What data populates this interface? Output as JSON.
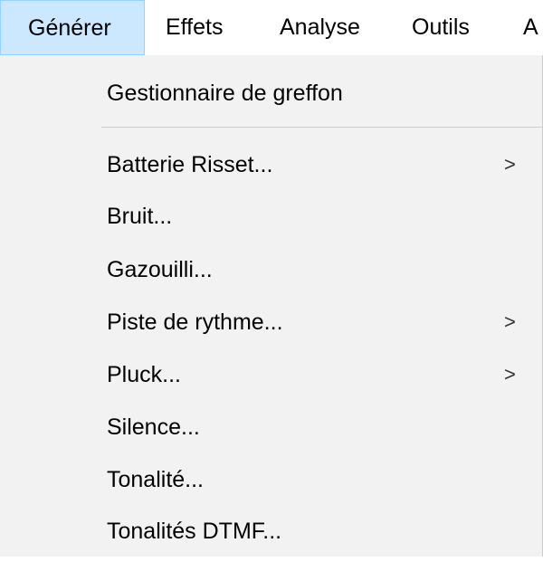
{
  "menubar": {
    "items": [
      {
        "label": "Générer",
        "active": true
      },
      {
        "label": "Effets"
      },
      {
        "label": "Analyse"
      },
      {
        "label": "Outils"
      },
      {
        "label": "A"
      }
    ]
  },
  "menu": {
    "header_item": "Gestionnaire de greffon",
    "items": [
      {
        "label": "Batterie Risset...",
        "submenu": true
      },
      {
        "label": "Bruit..."
      },
      {
        "label": "Gazouilli..."
      },
      {
        "label": "Piste de rythme...",
        "submenu": true
      },
      {
        "label": "Pluck...",
        "submenu": true
      },
      {
        "label": "Silence..."
      },
      {
        "label": "Tonalité..."
      },
      {
        "label": "Tonalités DTMF..."
      }
    ],
    "submenu_arrow": ">"
  },
  "colors": {
    "menubar_bg": "#ffffff",
    "active_bg": "#cce8ff",
    "menu_bg": "#f2f2f2",
    "separator": "#cfcfcf"
  }
}
